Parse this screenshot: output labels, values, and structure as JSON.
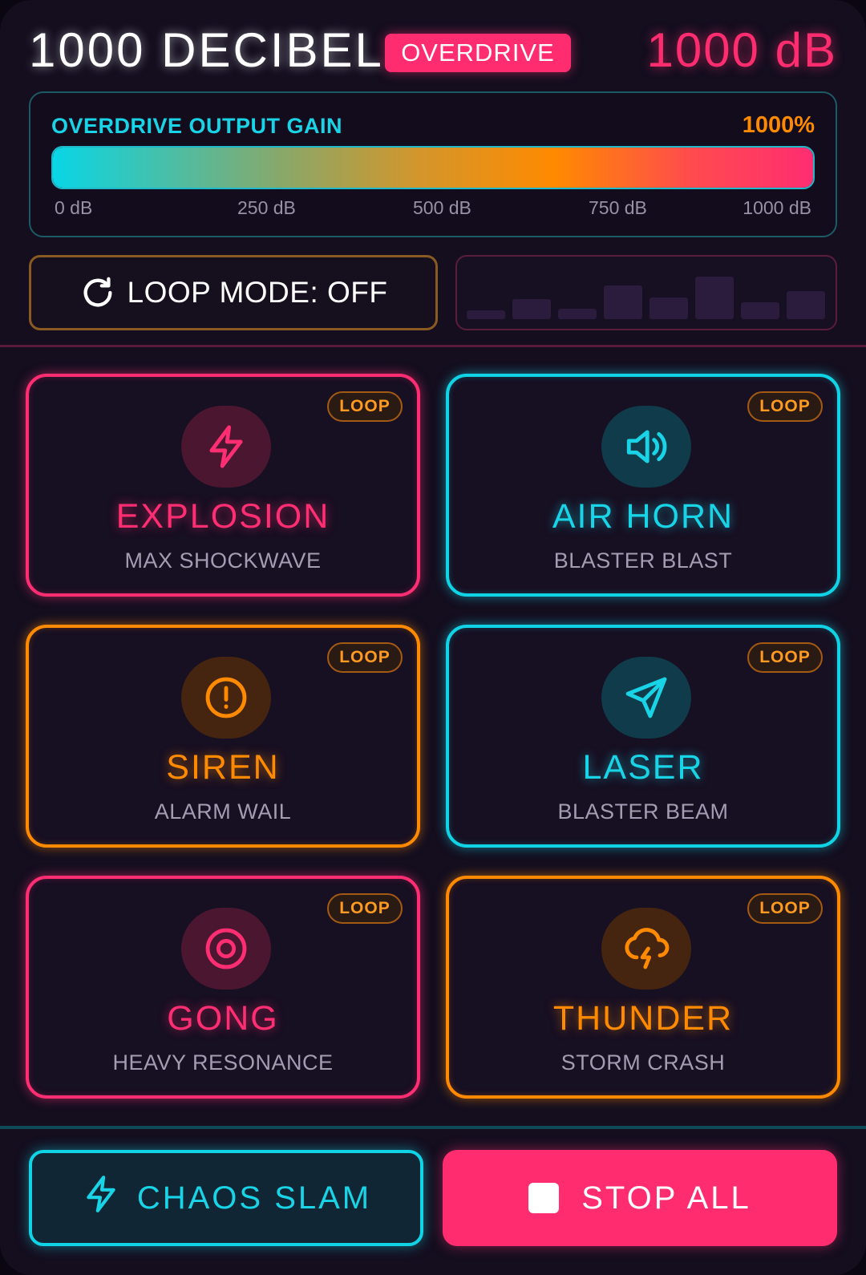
{
  "header": {
    "title": "1000 DECIBEL",
    "mode_badge": "OVERDRIVE",
    "db_readout": "1000 dB"
  },
  "gain": {
    "label": "OVERDRIVE OUTPUT GAIN",
    "value_text": "1000%",
    "fill_fraction": 1.0,
    "ticks": [
      "0 dB",
      "250 dB",
      "500 dB",
      "750 dB",
      "1000 dB"
    ]
  },
  "loop_mode": {
    "label": "LOOP MODE: OFF",
    "icon": "refresh-icon"
  },
  "visualizer": {
    "levels": [
      0.15,
      0.35,
      0.18,
      0.6,
      0.38,
      0.75,
      0.3,
      0.5
    ]
  },
  "pads": [
    {
      "title": "EXPLOSION",
      "subtitle": "MAX SHOCKWAVE",
      "loop": "LOOP",
      "icon": "lightning-icon",
      "color": "pink"
    },
    {
      "title": "AIR HORN",
      "subtitle": "BLASTER BLAST",
      "loop": "LOOP",
      "icon": "speaker-icon",
      "color": "cyan"
    },
    {
      "title": "SIREN",
      "subtitle": "ALARM WAIL",
      "loop": "LOOP",
      "icon": "alert-icon",
      "color": "orange"
    },
    {
      "title": "LASER",
      "subtitle": "BLASTER BEAM",
      "loop": "LOOP",
      "icon": "send-icon",
      "color": "cyan"
    },
    {
      "title": "GONG",
      "subtitle": "HEAVY RESONANCE",
      "loop": "LOOP",
      "icon": "target-icon",
      "color": "pink"
    },
    {
      "title": "THUNDER",
      "subtitle": "STORM CRASH",
      "loop": "LOOP",
      "icon": "storm-icon",
      "color": "orange"
    }
  ],
  "footer": {
    "chaos_label": "CHAOS SLAM",
    "stop_label": "STOP ALL"
  },
  "colors": {
    "pink": "#ff2d72",
    "cyan": "#10d4e6",
    "orange": "#ff8a00",
    "background": "#140e1f"
  }
}
